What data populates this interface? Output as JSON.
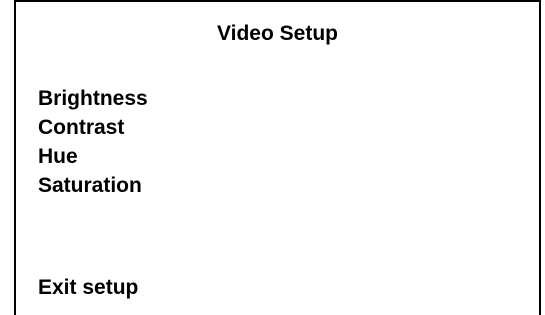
{
  "menu": {
    "title": "Video Setup",
    "items": [
      {
        "label": "Brightness"
      },
      {
        "label": "Contrast"
      },
      {
        "label": "Hue"
      },
      {
        "label": "Saturation"
      }
    ],
    "exit_label": "Exit setup"
  },
  "colors": {
    "background": "#ffffff",
    "text": "#000000",
    "border": "#000000"
  }
}
